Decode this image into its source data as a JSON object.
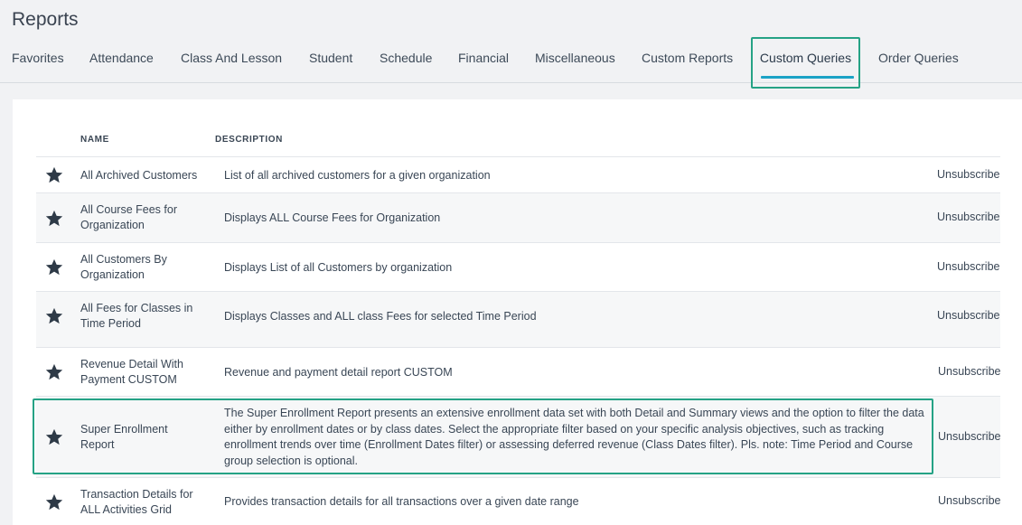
{
  "page": {
    "title": "Reports"
  },
  "tabs": [
    {
      "label": "Favorites"
    },
    {
      "label": "Attendance"
    },
    {
      "label": "Class And Lesson"
    },
    {
      "label": "Student"
    },
    {
      "label": "Schedule"
    },
    {
      "label": "Financial"
    },
    {
      "label": "Miscellaneous"
    },
    {
      "label": "Custom Reports"
    },
    {
      "label": "Custom Queries",
      "active": true
    },
    {
      "label": "Order Queries"
    }
  ],
  "table": {
    "headers": {
      "name": "NAME",
      "description": "DESCRIPTION"
    },
    "rows": [
      {
        "name": "All Archived Customers",
        "description": "List of all archived customers for a given organization",
        "action": "Unsubscribe",
        "favorite_icon": "star-icon"
      },
      {
        "name": "All Course Fees for Organization",
        "description": "Displays ALL Course Fees for Organization",
        "action": "Unsubscribe",
        "favorite_icon": "star-icon"
      },
      {
        "name": "All Customers By Organization",
        "description": "Displays List of all Customers by organization",
        "action": "Unsubscribe",
        "favorite_icon": "star-icon"
      },
      {
        "name": "All Fees for Classes in Time Period",
        "description": "Displays Classes and ALL class Fees for selected Time Period",
        "action": "Unsubscribe",
        "favorite_icon": "star-icon"
      },
      {
        "name": "Revenue Detail With Payment CUSTOM",
        "description": "Revenue and payment detail report CUSTOM",
        "action": "Unsubscribe",
        "favorite_icon": "star-icon"
      },
      {
        "name": "Super Enrollment Report",
        "description": "The Super Enrollment Report presents an extensive enrollment data set with both Detail and Summary views and the option to filter the data either by enrollment dates or by class dates. Select the appropriate filter based on your specific analysis objectives, such as tracking enrollment trends over time (Enrollment Dates filter) or assessing deferred revenue (Class Dates filter). Pls. note: Time Period and Course group selection is optional.",
        "action": "Unsubscribe",
        "favorite_icon": "star-icon"
      },
      {
        "name": "Transaction Details for ALL Activities Grid",
        "description": "Provides transaction details for all transactions over a given date range",
        "action": "Unsubscribe",
        "favorite_icon": "star-icon"
      }
    ]
  },
  "colors": {
    "accent": "#1ba3c6",
    "highlight": "#25a285",
    "star": "#2e3a47"
  }
}
